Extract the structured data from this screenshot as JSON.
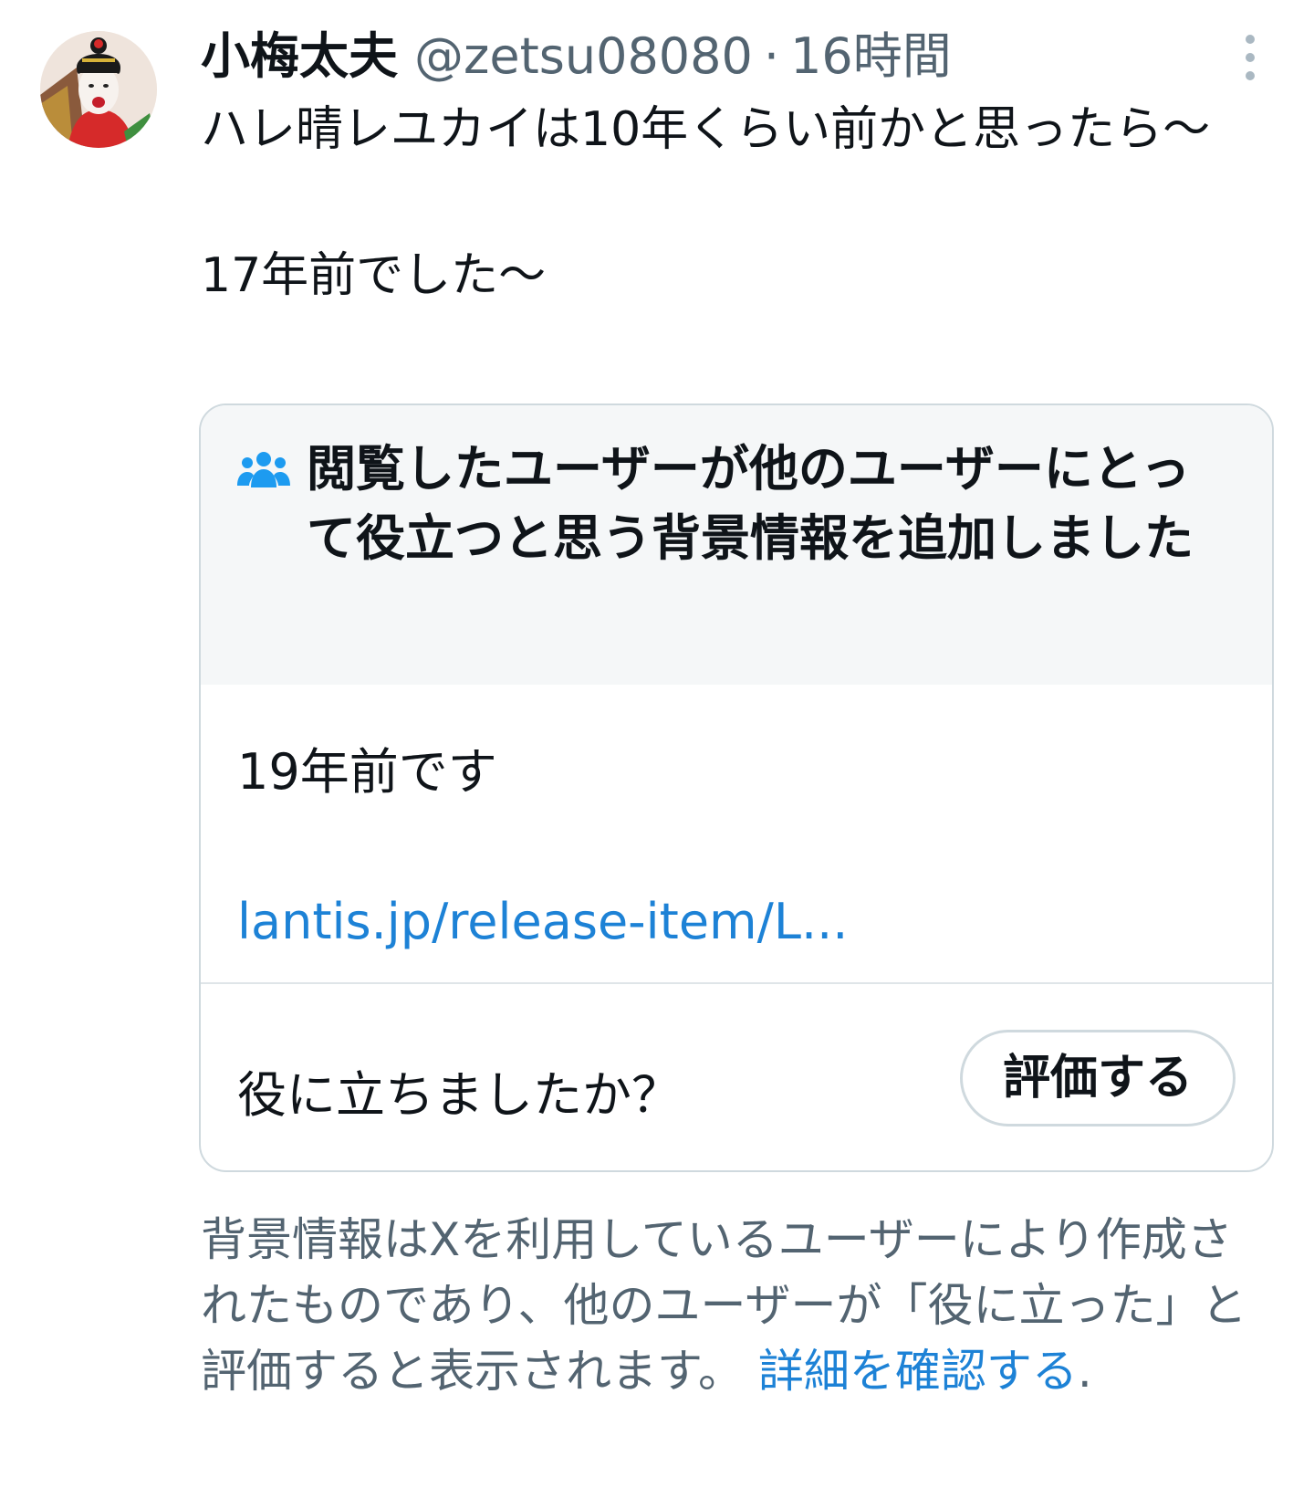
{
  "tweet": {
    "author_name": "小梅太夫",
    "handle": "@zetsu08080",
    "separator": "·",
    "time": "16時間",
    "text_line1": "ハレ晴レユカイは10年くらい前かと思ったら〜",
    "text_line2": "17年前でした〜"
  },
  "community_note": {
    "title": "閲覧したユーザーが他のユーザーにとって役立つと思う背景情報を追加しました",
    "body": "19年前です",
    "link_text": "lantis.jp/release-item/L...",
    "question": "役に立ちましたか？",
    "rate_button": "評価する"
  },
  "footnote": {
    "text": "背景情報はXを利用しているユーザーにより作成されたものであり、他のユーザーが「役に立った」と評価すると表示されます。",
    "link": "詳細を確認する",
    "end": "."
  },
  "colors": {
    "link": "#1d82d6",
    "muted_text": "#536471",
    "note_header_bg": "#f5f7f8",
    "border": "#cfd9de"
  },
  "icons": {
    "more": "vertical-dots-icon",
    "note": "people-icon"
  }
}
